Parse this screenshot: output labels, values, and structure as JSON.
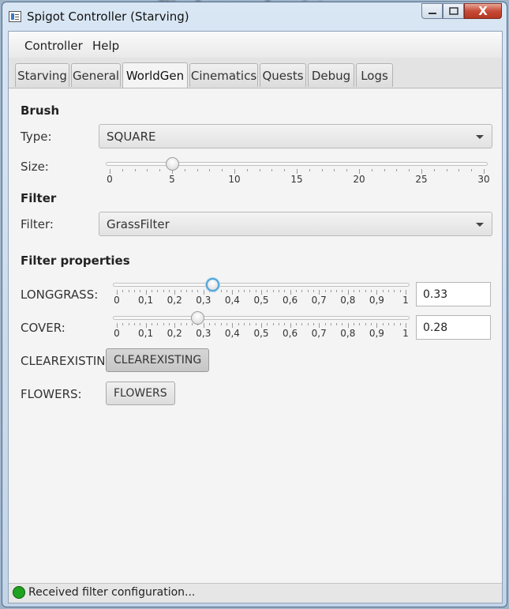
{
  "window": {
    "title": "Spigot Controller (Starving)",
    "close_glyph": "X"
  },
  "menu": [
    "Controller",
    "Help"
  ],
  "tabs": [
    "Starving",
    "General",
    "WorldGen",
    "Cinematics",
    "Quests",
    "Debug",
    "Logs"
  ],
  "active_tab": "WorldGen",
  "brush": {
    "heading": "Brush",
    "type_label": "Type:",
    "type_value": "SQUARE",
    "size_label": "Size:",
    "size_ticks": [
      "0",
      "5",
      "10",
      "15",
      "20",
      "25",
      "30"
    ],
    "size_value": 5,
    "size_range": [
      0,
      30
    ]
  },
  "filter": {
    "heading": "Filter",
    "filter_label": "Filter:",
    "filter_value": "GrassFilter"
  },
  "filter_properties": {
    "heading": "Filter properties",
    "ticks": [
      "0",
      "0,1",
      "0,2",
      "0,3",
      "0,4",
      "0,5",
      "0,6",
      "0,7",
      "0,8",
      "0,9",
      "1"
    ],
    "longgrass": {
      "label": "LONGGRASS:",
      "value": 0.33,
      "text": "0.33"
    },
    "cover": {
      "label": "COVER:",
      "value": 0.28,
      "text": "0.28"
    },
    "clearexisting": {
      "label": "CLEAREXISTING:",
      "button": "CLEAREXISTING"
    },
    "flowers": {
      "label": "FLOWERS:",
      "button": "FLOWERS"
    }
  },
  "status": {
    "text": "Received filter configuration...",
    "color": "#1fa21f"
  },
  "colors": {
    "focus": "#4fa4d8",
    "close": "#c74b36"
  }
}
